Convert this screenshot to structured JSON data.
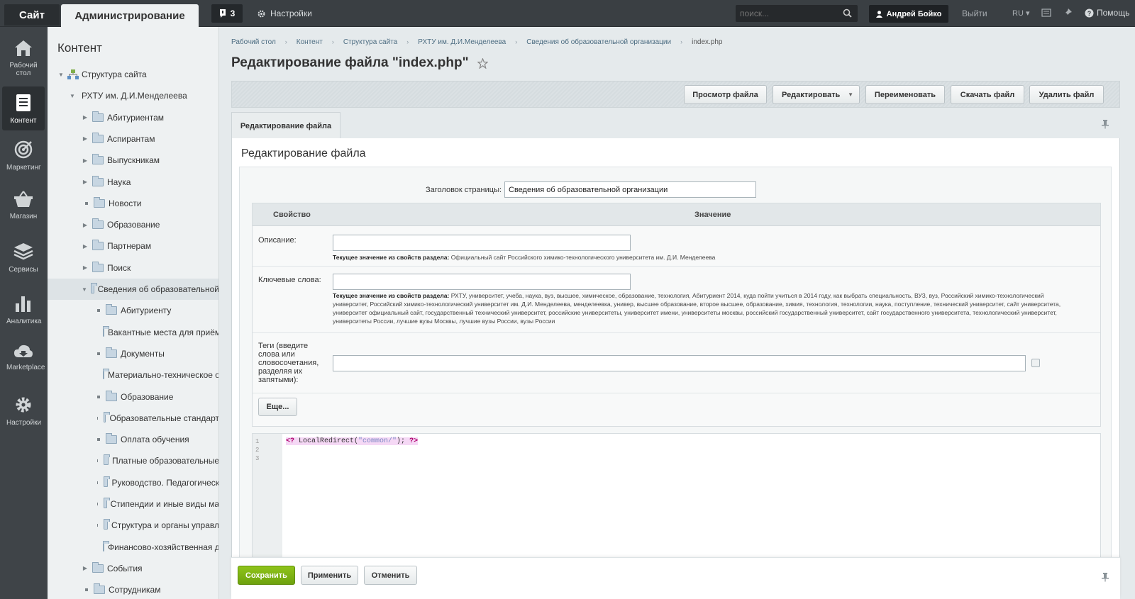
{
  "topbar": {
    "site_label": "Сайт",
    "admin_label": "Администрирование",
    "notifications_count": "3",
    "settings_label": "Настройки",
    "search_placeholder": "поиск...",
    "user_name": "Андрей Бойко",
    "logout_label": "Выйти",
    "lang_label": "RU",
    "help_label": "Помощь"
  },
  "leftmenu": [
    {
      "label": "Рабочий стол",
      "icon": "home-icon"
    },
    {
      "label": "Контент",
      "icon": "document-icon",
      "active": true
    },
    {
      "label": "Маркетинг",
      "icon": "target-icon"
    },
    {
      "label": "Магазин",
      "icon": "basket-icon"
    },
    {
      "label": "Сервисы",
      "icon": "layers-icon"
    },
    {
      "label": "Аналитика",
      "icon": "bar-chart-icon"
    },
    {
      "label": "Marketplace",
      "icon": "cloud-download-icon"
    },
    {
      "label": "Настройки",
      "icon": "gear-icon"
    }
  ],
  "tree": {
    "title": "Контент",
    "items": [
      {
        "label": "Структура сайта",
        "type": "root"
      },
      {
        "label": "РХТУ им. Д.И.Менделеева",
        "type": "site"
      },
      {
        "label": "Абитуриентам",
        "type": "folder-arrow"
      },
      {
        "label": "Аспирантам",
        "type": "folder-arrow"
      },
      {
        "label": "Выпускникам",
        "type": "folder-arrow"
      },
      {
        "label": "Наука",
        "type": "folder-arrow"
      },
      {
        "label": "Новости",
        "type": "folder-dot"
      },
      {
        "label": "Образование",
        "type": "folder-arrow"
      },
      {
        "label": "Партнерам",
        "type": "folder-arrow"
      },
      {
        "label": "Поиск",
        "type": "folder-arrow"
      },
      {
        "label": "Сведения об образовательной",
        "type": "folder-open",
        "selected": true
      },
      {
        "label": "Абитуриенту",
        "type": "sub"
      },
      {
        "label": "Вакантные места для приём",
        "type": "sub"
      },
      {
        "label": "Документы",
        "type": "sub"
      },
      {
        "label": "Материально-техническое о",
        "type": "sub"
      },
      {
        "label": "Образование",
        "type": "sub"
      },
      {
        "label": "Образовательные стандарт",
        "type": "sub"
      },
      {
        "label": "Оплата обучения",
        "type": "sub"
      },
      {
        "label": "Платные образовательные",
        "type": "sub"
      },
      {
        "label": "Руководство. Педагогическ",
        "type": "sub"
      },
      {
        "label": "Стипендии и иные виды ма",
        "type": "sub"
      },
      {
        "label": "Структура и органы управл",
        "type": "sub"
      },
      {
        "label": "Финансово-хозяйственная д",
        "type": "sub"
      },
      {
        "label": "События",
        "type": "folder-arrow"
      },
      {
        "label": "Сотрудникам",
        "type": "folder-dot"
      }
    ]
  },
  "breadcrumb": [
    "Рабочий стол",
    "Контент",
    "Структура сайта",
    "РХТУ им. Д.И.Менделеева",
    "Сведения об образовательной организации",
    "index.php"
  ],
  "page_title": "Редактирование файла \"index.php\"",
  "toolbar": {
    "view": "Просмотр файла",
    "edit": "Редактировать",
    "rename": "Переименовать",
    "download": "Скачать файл",
    "delete": "Удалить файл"
  },
  "tab_label": "Редактирование файла",
  "panel_title": "Редактирование файла",
  "form": {
    "page_title_label": "Заголовок страницы:",
    "page_title_value": "Сведения об образовательной организации",
    "col_property": "Свойство",
    "col_value": "Значение",
    "description_label": "Описание:",
    "description_note_prefix": "Текущее значение из свойств раздела:",
    "description_note": " Официальный сайт Российского химико-технологического университета им. Д.И. Менделеева",
    "keywords_label": "Ключевые слова:",
    "keywords_note_prefix": "Текущее значение из свойств раздела:",
    "keywords_note": " РХТУ, университет, учеба, наука, вуз, высшее, химическое, образование, технология, Абитуриент 2014, куда пойти учиться в 2014 году, как выбрать специальность, ВУЗ, вуз, Российский химико-технологический университет, Российский химико-технологический университет им. Д.И. Менделеева, менделеевка, универ, высшее образование, второе высшее, образование, химия, технология, технологии, наука, поступление, технический университет, сайт университета, университет официальный сайт, государственный технический университет, российские университеты, университет имени, университеты москвы, российский государственный университет, сайт государственного университета, технологический университет, университеты России, лучшие вузы Москвы, лучшие вузы России, вузы России",
    "tags_label": "Теги (введите слова или словосочетания, разделяя их запятыми):",
    "more_label": "Еще..."
  },
  "code": {
    "lines": [
      "1",
      "2",
      "3"
    ],
    "open_tag": "<?",
    "call": " LocalRedirect(",
    "arg": "\"common/\"",
    "close": "); ",
    "close_tag": "?>"
  },
  "bottom": {
    "save": "Сохранить",
    "apply": "Применить",
    "cancel": "Отменить"
  }
}
